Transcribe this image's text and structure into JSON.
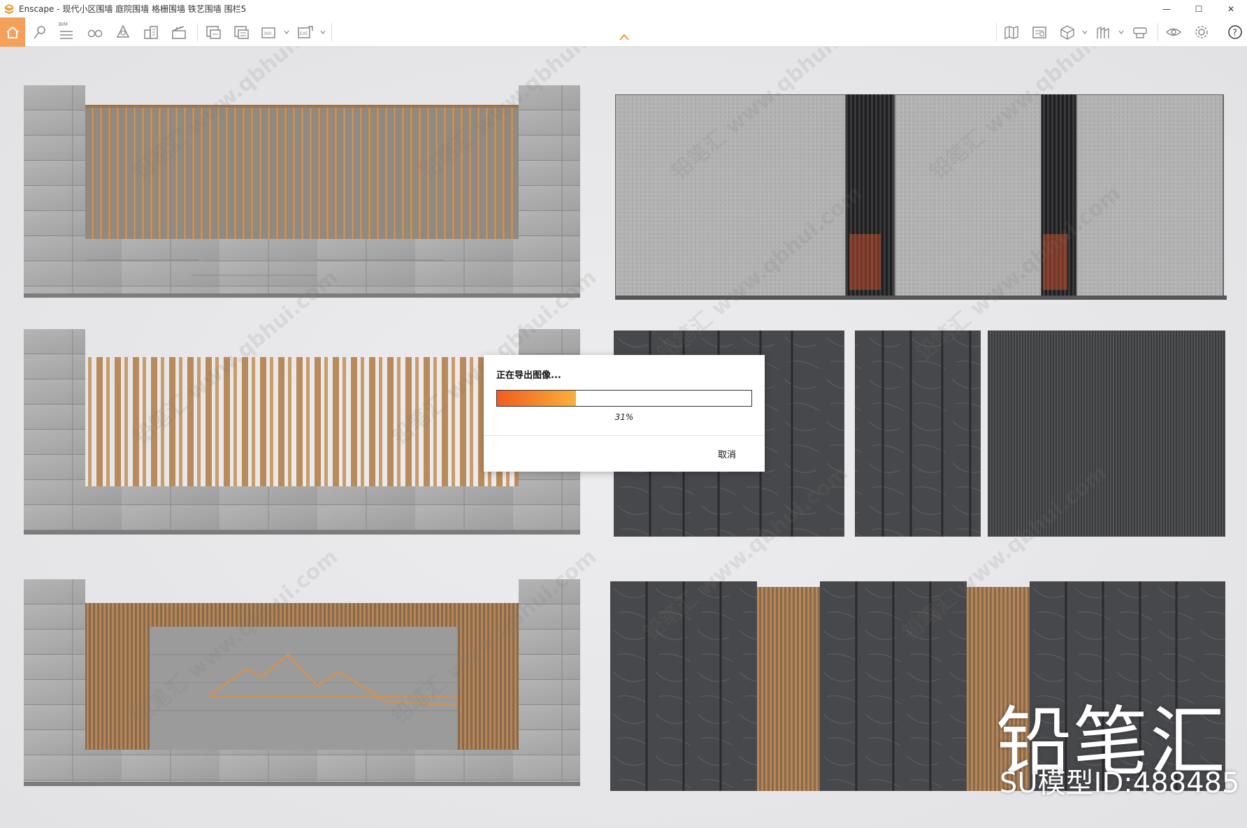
{
  "window": {
    "title": "Enscape - 现代小区围墙 庭院围墙 格栅围墙 铁艺围墙 围栏5",
    "minimize": "—",
    "maximize": "☐",
    "close": "✕"
  },
  "toolbar": {
    "bim_label": "BIM",
    "icons": [
      "home-icon",
      "location-pin-icon",
      "list-icon",
      "binoculars-icon",
      "shield-icon",
      "building-icon",
      "clapperboard-icon",
      "screenshot-icon",
      "batch-render-icon",
      "panorama-360-icon",
      "export-exe-icon",
      "map-icon",
      "asset-library-icon",
      "cube-icon",
      "hat-icon",
      "settings-pack-icon",
      "eye-icon",
      "gear-icon",
      "help-icon"
    ]
  },
  "dialog": {
    "title": "正在导出图像...",
    "progress_percent_label": "31%",
    "progress": 0.31,
    "cancel_label": "取消"
  },
  "watermark": {
    "brand": "铅笔汇",
    "model_id": "SU模型ID:488485",
    "tile_text": "铅笔汇 www.qbhui.com"
  },
  "colors": {
    "accent": "#f5a05a",
    "progress_start": "#f25c20",
    "progress_end": "#f7b23a",
    "wood": "#b88a5c",
    "concrete": "#a9a9a9",
    "slate": "#3f4043"
  }
}
